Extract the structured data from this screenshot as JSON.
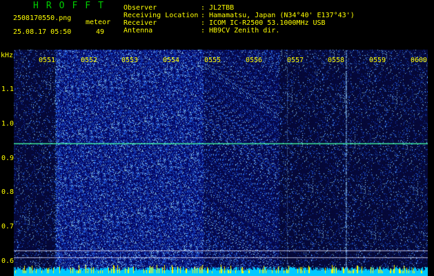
{
  "app": {
    "title": "HROFFT"
  },
  "file": {
    "name": "2508170550.png",
    "datetime": "25.08.17 05:50"
  },
  "meteor": {
    "label": "meteor",
    "count": "49"
  },
  "info": [
    {
      "label": "Observer",
      "value": "JL2TBB"
    },
    {
      "label": "Receiving Location",
      "value": "Hamamatsu, Japan (N34°40' E137°43')"
    },
    {
      "label": "Receiver",
      "value": "ICOM IC-R2500 53.1000MHz USB"
    },
    {
      "label": "Antenna",
      "value": "HB9CV Zenith dir."
    }
  ],
  "separator": ":",
  "colors": {
    "text": "#ffff00",
    "title": "#00d000",
    "background": "#000000",
    "signal": "#40ffa0",
    "grid": "#ffffff"
  },
  "chart_data": {
    "type": "heatmap",
    "ylabel": "kHz",
    "yticks": [
      "1.1",
      "1.0",
      "0.9",
      "0.8",
      "0.7",
      "0.6"
    ],
    "ytick_values": [
      1.1,
      1.0,
      0.9,
      0.8,
      0.7,
      0.6
    ],
    "ylim": [
      0.575,
      1.2
    ],
    "xticks": [
      "0551",
      "0552",
      "0553",
      "0554",
      "0555",
      "0556",
      "0557",
      "0558",
      "0559",
      "0600"
    ],
    "xlim": [
      "0550",
      "0600"
    ],
    "signals": [
      {
        "freq_khz": 0.93,
        "from": "0551",
        "to": "0600"
      }
    ],
    "reference_lines_khz": [
      0.62,
      0.6
    ]
  }
}
